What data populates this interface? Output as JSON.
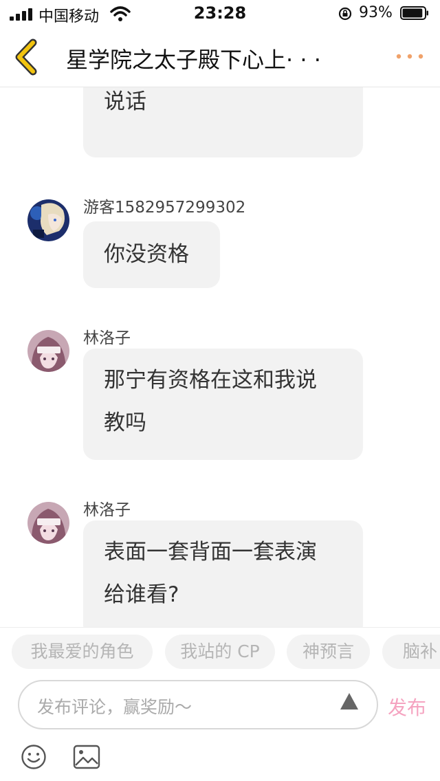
{
  "status": {
    "carrier": "中国移动",
    "time": "23:28",
    "battery": "93%",
    "battery_level": 0.93
  },
  "nav": {
    "title": "星学院之太子殿下心上· · ·"
  },
  "messages": [
    {
      "text_lines": [
        "说话"
      ]
    },
    {
      "user": "游客1582957299302",
      "text_lines": [
        "你没资格"
      ]
    },
    {
      "user": "林洛子",
      "text_lines": [
        "那宁有资格在这和我说",
        "教吗"
      ]
    },
    {
      "user": "林洛子",
      "text_lines": [
        "表面一套背面一套表演",
        "给谁看?"
      ]
    }
  ],
  "tags": [
    "我最爱的角色",
    "我站的 CP",
    "神预言",
    "脑补"
  ],
  "input": {
    "placeholder": "发布评论，赢奖励～",
    "send_label": "发布"
  },
  "colors": {
    "accent_back": "#f2c40f",
    "more_dots": "#f0a26a",
    "send": "#f5a3c0",
    "bubble": "#f2f2f2"
  }
}
